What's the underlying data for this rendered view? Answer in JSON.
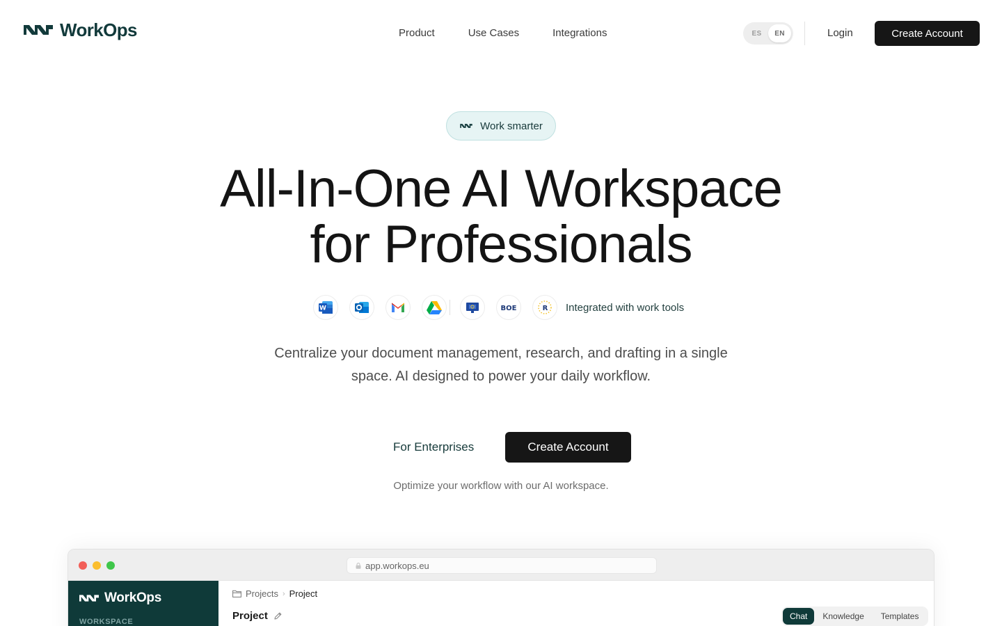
{
  "brand": {
    "name": "WorkOps",
    "accent": "#0f3a39",
    "logo_icon": "workops-wave-logo"
  },
  "nav": {
    "links": [
      "Product",
      "Use Cases",
      "Integrations"
    ],
    "languages": [
      "ES",
      "EN"
    ],
    "active_language": "EN",
    "login": "Login",
    "cta": "Create Account"
  },
  "hero": {
    "badge": "Work smarter",
    "title_line1": "All-In-One AI Workspace",
    "title_line2": "for Professionals",
    "tools_label": "Integrated with work tools",
    "tool_icons": [
      "word-icon",
      "outlook-icon",
      "gmail-icon",
      "google-drive-icon",
      "eu-publications-icon",
      "boe-icon",
      "eu-stars-icon"
    ],
    "subtitle": "Centralize your document management, research, and drafting in a single space. AI designed to power your daily workflow.",
    "secondary_cta": "For Enterprises",
    "primary_cta": "Create Account",
    "note": "Optimize your workflow with our AI workspace."
  },
  "preview": {
    "url": "app.workops.eu",
    "sidebar_brand": "WorkOps",
    "sidebar_section": "WORKSPACE",
    "breadcrumb": [
      "Projects",
      "Project"
    ],
    "project_title": "Project",
    "tabs": [
      "Chat",
      "Knowledge",
      "Templates"
    ],
    "active_tab": "Chat"
  }
}
